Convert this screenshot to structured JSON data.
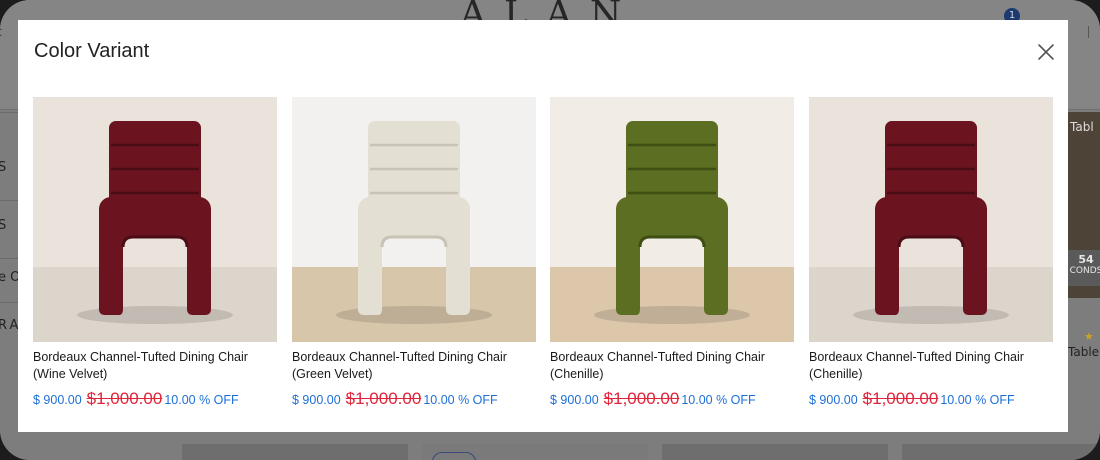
{
  "background": {
    "search_fragment": "rc",
    "logo_text": "ALAN",
    "cart_count": "1",
    "sidebar_fragments": [
      "S",
      "S",
      "e O",
      "RA"
    ],
    "timer_value": "54",
    "timer_unit": "CONDS",
    "right_card_label": "Tabl",
    "right_card_text": "Table",
    "star": "★"
  },
  "modal": {
    "title": "Color Variant",
    "close_icon": "close-icon",
    "products": [
      {
        "name": "Bordeaux Channel-Tufted Dining Chair (Wine Velvet)",
        "price": "$ 900.00",
        "old_price": "$1,000.00",
        "discount": "10.00 % OFF",
        "chair_color": "#6b1420",
        "chair_shade": "#4a0c15",
        "backdrop": "#e9e3dc",
        "floor": "#dcd5cc"
      },
      {
        "name": "Bordeaux Channel-Tufted Dining Chair (Green Velvet)",
        "price": "$ 900.00",
        "old_price": "$1,000.00",
        "discount": "10.00 % OFF",
        "chair_color": "#e4dfd3",
        "chair_shade": "#c9c3b6",
        "backdrop": "#f2f1ef",
        "floor": "#d8c6aa"
      },
      {
        "name": "Bordeaux Channel-Tufted Dining Chair (Chenille)",
        "price": "$ 900.00",
        "old_price": "$1,000.00",
        "discount": "10.00 % OFF",
        "chair_color": "#5b6e22",
        "chair_shade": "#3f4f14",
        "backdrop": "#f1ece6",
        "floor": "#dcc7ab"
      },
      {
        "name": "Bordeaux Channel-Tufted Dining Chair (Chenille)",
        "price": "$ 900.00",
        "old_price": "$1,000.00",
        "discount": "10.00 % OFF",
        "chair_color": "#6b1420",
        "chair_shade": "#4a0c15",
        "backdrop": "#e9e3dc",
        "floor": "#dcd5cc"
      }
    ]
  }
}
